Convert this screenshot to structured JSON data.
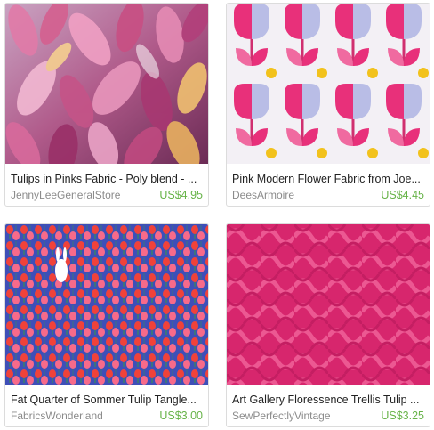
{
  "listings": [
    {
      "title": "Tulips in Pinks Fabric - Poly blend - ...",
      "shop": "JennyLeeGeneralStore",
      "price": "US$4.95"
    },
    {
      "title": "Pink Modern Flower Fabric from Joe...",
      "shop": "DeesArmoire",
      "price": "US$4.45"
    },
    {
      "title": "Fat Quarter of Sommer Tulip Tangle...",
      "shop": "FabricsWonderland",
      "price": "US$3.00"
    },
    {
      "title": "Art Gallery Floressence Trellis Tulip ...",
      "shop": "SewPerfectlyVintage",
      "price": "US$3.25"
    }
  ],
  "colors": {
    "price": "#67b348",
    "shop": "#8b8b8b",
    "border": "#dcdcdc"
  }
}
